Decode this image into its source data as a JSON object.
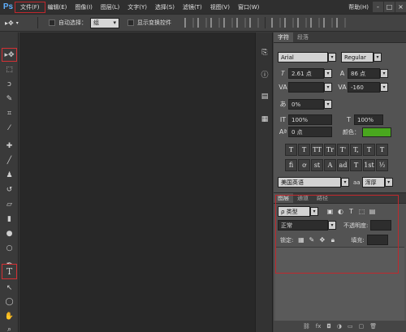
{
  "menubar": {
    "logo": "Ps",
    "items": [
      "文件(F)",
      "编辑(E)",
      "图像(I)",
      "图层(L)",
      "文字(Y)",
      "选择(S)",
      "滤镜(T)",
      "视图(V)",
      "窗口(W)"
    ],
    "help": "帮助(H)",
    "window_buttons": [
      "-",
      "□",
      "×"
    ]
  },
  "options": {
    "auto_select_label": "自动选择：",
    "auto_select_value": "组",
    "show_transform_label": "显示变换控件"
  },
  "character_panel": {
    "tabs": [
      "字符",
      "段落"
    ],
    "font_family": "Arial",
    "font_style": "Regular",
    "font_size": "2.61 点",
    "leading": "86 点",
    "kerning": "",
    "tracking": "-160",
    "scale_label": "0%",
    "vertical_scale": "100%",
    "horizontal_scale": "100%",
    "baseline_shift": "0 点",
    "color_label": "颜色：",
    "color": "#49a71e",
    "type_styles": [
      "T",
      "T",
      "TT",
      "Tr",
      "T'",
      "T,",
      "T",
      "T"
    ],
    "opentype": [
      "fi",
      "ơ",
      "st",
      "A",
      "ad",
      "T",
      "1st",
      "½"
    ],
    "language": "美国英语",
    "anti_alias_icon": "aa",
    "anti_alias": "浑厚"
  },
  "layers_panel": {
    "tabs": [
      "图层",
      "通道",
      "路径"
    ],
    "filter": "ρ 类型",
    "blend_mode": "正常",
    "opacity_label": "不透明度:",
    "lock_label": "锁定:",
    "fill_label": "填充:",
    "footer_icons": [
      "link-icon",
      "fx-icon",
      "mask-icon",
      "adjustment-icon",
      "group-icon",
      "new-layer-icon",
      "trash-icon"
    ]
  }
}
